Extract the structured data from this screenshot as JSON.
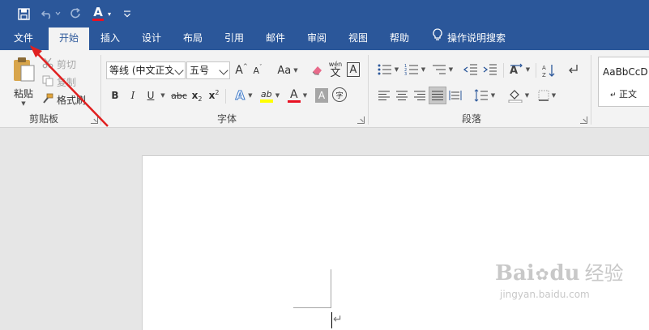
{
  "quick_access": {
    "save_icon": "save-icon",
    "undo_icon": "undo-icon",
    "redo_icon": "redo-icon",
    "font_color_label": "A",
    "customize_icon": "customize-qat-icon"
  },
  "menu": {
    "file": "文件",
    "home": "开始",
    "insert": "插入",
    "design": "设计",
    "layout": "布局",
    "references": "引用",
    "mailings": "邮件",
    "review": "审阅",
    "view": "视图",
    "help": "帮助",
    "tell_me": "操作说明搜索"
  },
  "clipboard": {
    "paste": "粘贴",
    "cut": "剪切",
    "copy": "复制",
    "format_painter": "格式刷",
    "group_label": "剪贴板"
  },
  "font": {
    "font_name": "等线 (中文正文",
    "font_size": "五号",
    "grow": "A",
    "change_case": "Aa",
    "phonetic_top": "wén",
    "phonetic_char": "文",
    "border_char": "A",
    "bold": "B",
    "italic": "I",
    "underline": "U",
    "strikethrough": "abc",
    "subscript": "x",
    "subscript_mark": "2",
    "superscript": "x",
    "superscript_mark": "2",
    "text_effects": "A",
    "highlight": "ab",
    "font_color": "A",
    "shading": "A",
    "enclosed_char": "字",
    "group_label": "字体"
  },
  "paragraph": {
    "group_label": "段落"
  },
  "styles": {
    "preview": "AaBbCcD",
    "normal": "正文"
  },
  "colors": {
    "brand": "#2b579a",
    "ribbon_bg": "#f3f3f3",
    "annotation_arrow": "#e02020",
    "font_color_red": "#e81123",
    "highlight_yellow": "#ffff00"
  },
  "watermark": {
    "brand_left": "Bai",
    "brand_mid": "du",
    "brand_cn": "经验",
    "domain": "jingyan.baidu.com"
  }
}
